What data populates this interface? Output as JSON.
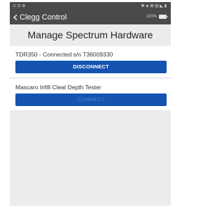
{
  "statusbar": {
    "left": "⊙ ⊡ ⊕",
    "right": "✱ ◈ ⊠ ▤ ◣ ▮"
  },
  "nav": {
    "back_label": "Clegg Control",
    "battery_text": "100%"
  },
  "page": {
    "title": "Manage Spectrum Hardware"
  },
  "devices": [
    {
      "label": "TDR350 - Connected s/n T36009330",
      "button": "DISCONNECT"
    },
    {
      "label": "Mascaro Infill Cleat Depth Tester",
      "button": "CONNECT"
    }
  ],
  "colors": {
    "accent": "#1553b0",
    "toolbar": "#4a4a4a",
    "background": "#ececec"
  }
}
